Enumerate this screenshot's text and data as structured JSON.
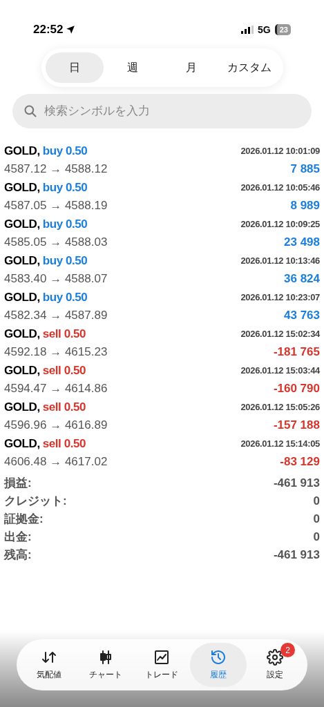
{
  "status_bar": {
    "time": "22:52",
    "network": "5G",
    "battery": "23"
  },
  "period_tabs": [
    {
      "label": "日",
      "selected": true
    },
    {
      "label": "週",
      "selected": false
    },
    {
      "label": "月",
      "selected": false
    },
    {
      "label": "カスタム",
      "selected": false
    }
  ],
  "search": {
    "placeholder": "検索シンボルを入力"
  },
  "trades": [
    {
      "symbol": "GOLD,",
      "kind": "buy",
      "order": "buy 0.50",
      "time": "2026.01.12 10:01:09",
      "prices": "4587.12 → 4588.12",
      "profit": "7 885"
    },
    {
      "symbol": "GOLD,",
      "kind": "buy",
      "order": "buy 0.50",
      "time": "2026.01.12 10:05:46",
      "prices": "4587.05 → 4588.19",
      "profit": "8 989"
    },
    {
      "symbol": "GOLD,",
      "kind": "buy",
      "order": "buy 0.50",
      "time": "2026.01.12 10:09:25",
      "prices": "4585.05 → 4588.03",
      "profit": "23 498"
    },
    {
      "symbol": "GOLD,",
      "kind": "buy",
      "order": "buy 0.50",
      "time": "2026.01.12 10:13:46",
      "prices": "4583.40 → 4588.07",
      "profit": "36 824"
    },
    {
      "symbol": "GOLD,",
      "kind": "buy",
      "order": "buy 0.50",
      "time": "2026.01.12 10:23:07",
      "prices": "4582.34 → 4587.89",
      "profit": "43 763"
    },
    {
      "symbol": "GOLD,",
      "kind": "sell",
      "order": "sell 0.50",
      "time": "2026.01.12 15:02:34",
      "prices": "4592.18 → 4615.23",
      "profit": "-181 765"
    },
    {
      "symbol": "GOLD,",
      "kind": "sell",
      "order": "sell 0.50",
      "time": "2026.01.12 15:03:44",
      "prices": "4594.47 → 4614.86",
      "profit": "-160 790"
    },
    {
      "symbol": "GOLD,",
      "kind": "sell",
      "order": "sell 0.50",
      "time": "2026.01.12 15:05:26",
      "prices": "4596.96 → 4616.89",
      "profit": "-157 188"
    },
    {
      "symbol": "GOLD,",
      "kind": "sell",
      "order": "sell 0.50",
      "time": "2026.01.12 15:14:05",
      "prices": "4606.48 → 4617.02",
      "profit": "-83 129"
    }
  ],
  "summary": [
    {
      "label": "損益:",
      "value": "-461 913"
    },
    {
      "label": "クレジット:",
      "value": "0"
    },
    {
      "label": "証拠金:",
      "value": "0"
    },
    {
      "label": "出金:",
      "value": "0"
    },
    {
      "label": "残高:",
      "value": "-461 913"
    }
  ],
  "bottom_nav": [
    {
      "kind": "quotes",
      "label": "気配値",
      "selected": false
    },
    {
      "kind": "chart",
      "label": "チャート",
      "selected": false
    },
    {
      "kind": "trade",
      "label": "トレード",
      "selected": false
    },
    {
      "kind": "history",
      "label": "履歴",
      "selected": true
    },
    {
      "kind": "settings",
      "label": "設定",
      "selected": false,
      "badge": "2"
    }
  ]
}
